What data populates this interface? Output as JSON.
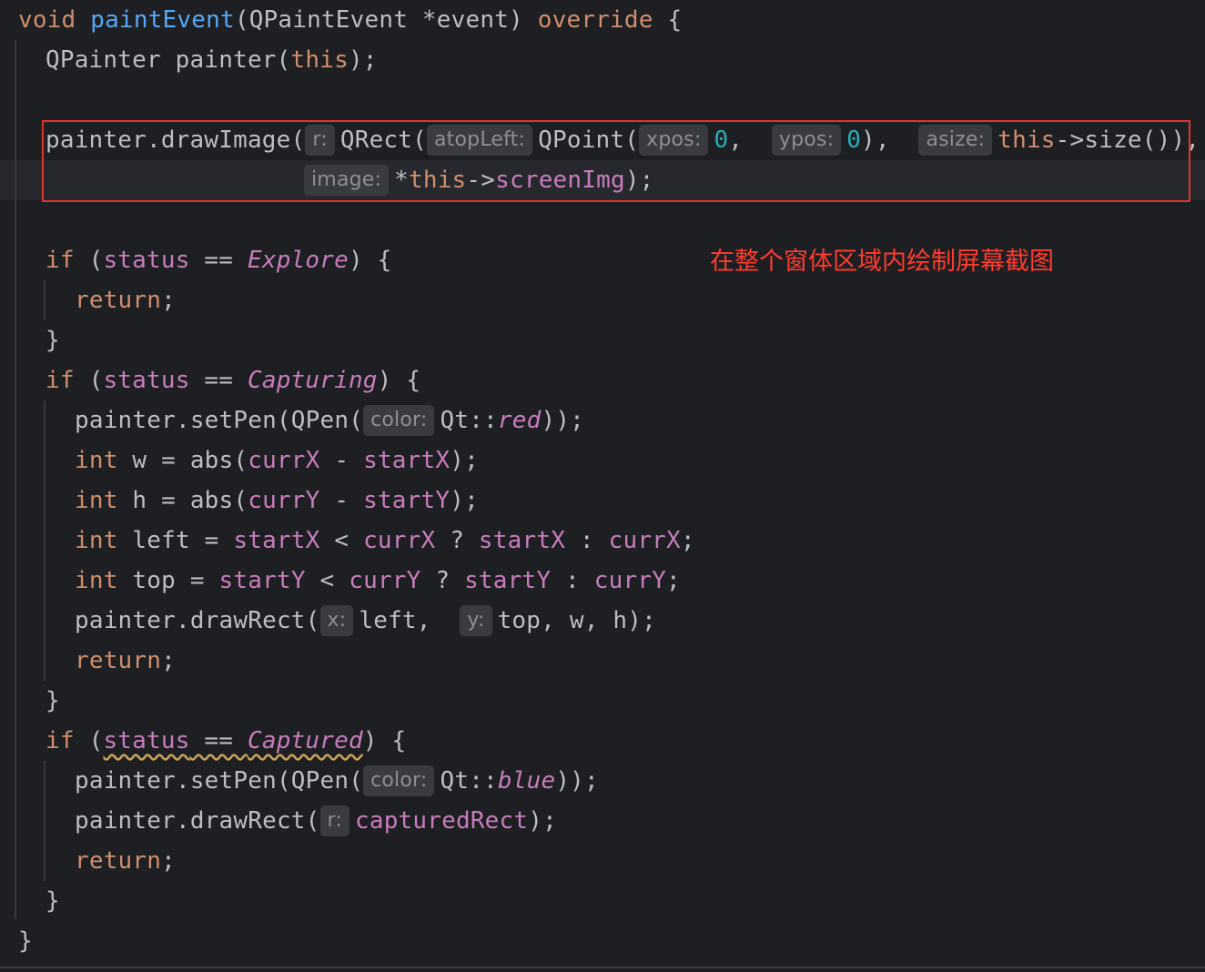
{
  "annotation": "在整个窗体区域内绘制屏幕截图",
  "code": {
    "l1": {
      "kw_void": "void",
      "fn": "paintEvent",
      "open": "(",
      "type": "QPaintEvent",
      "param": " *event) ",
      "kw_override": "override",
      "brace": " {"
    },
    "l2": {
      "type": "QPainter",
      "name": " painter(",
      "kw_this": "this",
      "end": ");"
    },
    "l3": {
      "a": "painter.drawImage(",
      "hint_r": "r:",
      "b": "QRect(",
      "hint_atopLeft": "atopLeft:",
      "c": "QPoint(",
      "hint_xpos": "xpos:",
      "zero1": "0",
      "comma1": ",  ",
      "hint_ypos": "ypos:",
      "zero2": "0",
      "d": "),  ",
      "hint_asize": "asize:",
      "kw_this": "this",
      "e": "->size()),"
    },
    "l4": {
      "hint_image": "image:",
      "star": "*",
      "kw_this": "this",
      "arrow": "->",
      "field": "screenImg",
      "end": ");"
    },
    "l5": {
      "kw_if": "if",
      "open": " (",
      "field": "status",
      "op": " == ",
      "enum": "Explore",
      "end": ") {"
    },
    "l6": {
      "kw_return": "return",
      "end": ";"
    },
    "l7": {
      "brace": "}"
    },
    "l8": {
      "kw_if": "if",
      "open": " (",
      "field": "status",
      "op": " == ",
      "enum": "Capturing",
      "end": ") {"
    },
    "l9": {
      "a": "painter.setPen(QPen(",
      "hint_color": "color:",
      "b": "Qt::",
      "enum": "red",
      "end": "));"
    },
    "l10": {
      "kw_int": "int",
      "a": " w = abs(",
      "f1": "currX",
      "op": " - ",
      "f2": "startX",
      "end": ");"
    },
    "l11": {
      "kw_int": "int",
      "a": " h = abs(",
      "f1": "currY",
      "op": " - ",
      "f2": "startY",
      "end": ");"
    },
    "l12": {
      "kw_int": "int",
      "a": " left = ",
      "f1": "startX",
      "op1": " < ",
      "f2": "currX",
      "op2": " ? ",
      "f3": "startX",
      "op3": " : ",
      "f4": "currX",
      "end": ";"
    },
    "l13": {
      "kw_int": "int",
      "a": " top = ",
      "f1": "startY",
      "op1": " < ",
      "f2": "currY",
      "op2": " ? ",
      "f3": "startY",
      "op3": " : ",
      "f4": "currY",
      "end": ";"
    },
    "l14": {
      "a": "painter.drawRect(",
      "hint_x": "x:",
      "b": "left,  ",
      "hint_y": "y:",
      "c": "top, w, h);"
    },
    "l15": {
      "kw_return": "return",
      "end": ";"
    },
    "l16": {
      "brace": "}"
    },
    "l17": {
      "kw_if": "if",
      "open": " (",
      "field": "status",
      "op": " == ",
      "enum": "Captured",
      "end": ") {"
    },
    "l18": {
      "a": "painter.setPen(QPen(",
      "hint_color": "color:",
      "b": "Qt::",
      "enum": "blue",
      "end": "));"
    },
    "l19": {
      "a": "painter.drawRect(",
      "hint_r": "r:",
      "field": "capturedRect",
      "end": ");"
    },
    "l20": {
      "kw_return": "return",
      "end": ";"
    },
    "l21": {
      "brace": "}"
    },
    "l22": {
      "brace": "}"
    }
  }
}
